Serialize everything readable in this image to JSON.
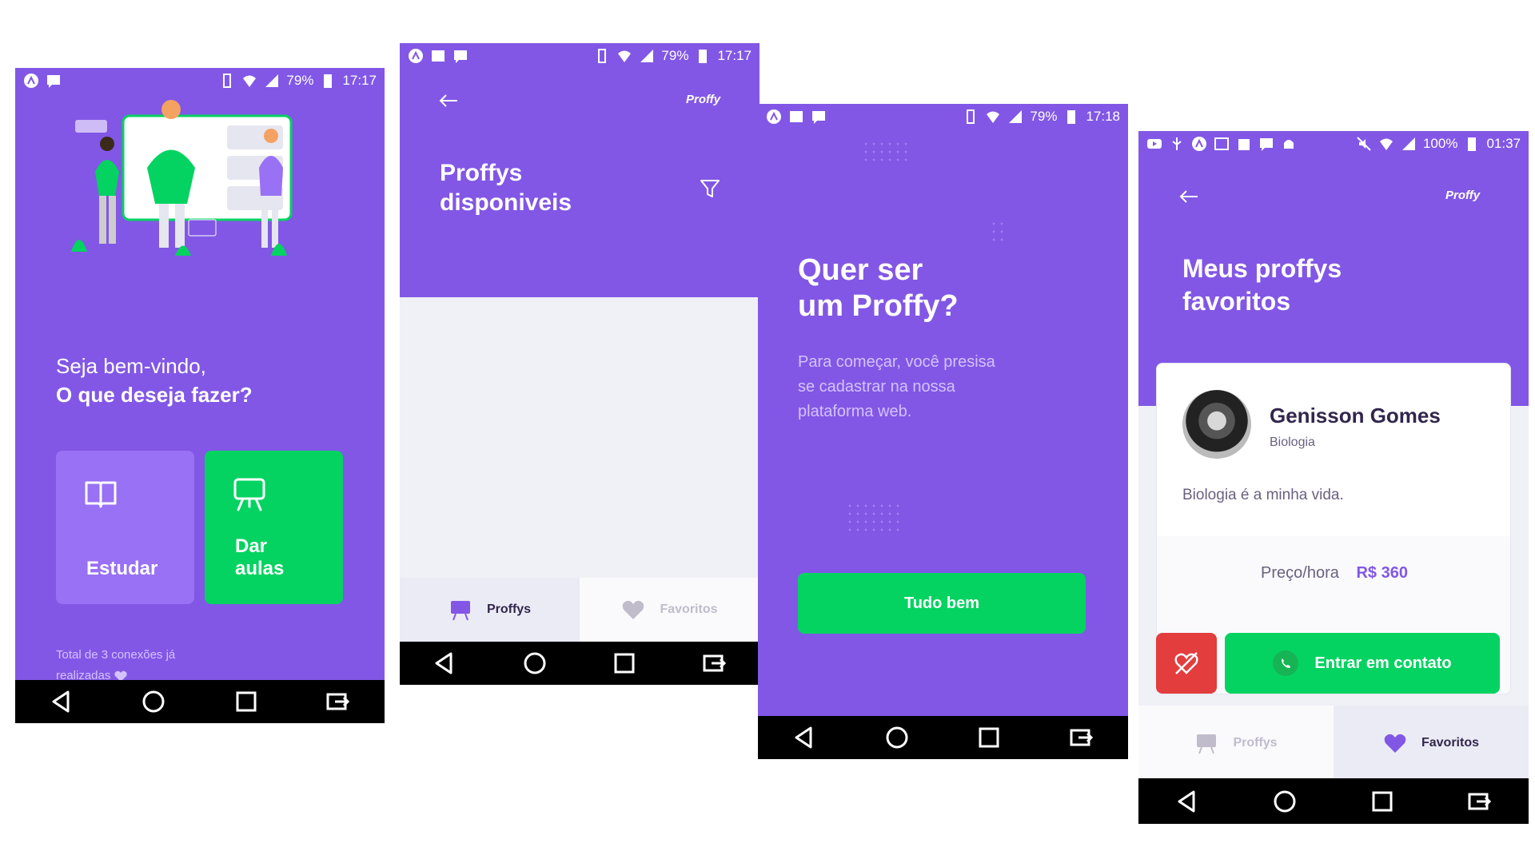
{
  "colors": {
    "purple": "#8257E5",
    "purple_light": "#9871F5",
    "green": "#04D361",
    "red": "#E33D3D",
    "bg": "#F0F0F7"
  },
  "screen1": {
    "status": {
      "battery": "79%",
      "time": "17:17"
    },
    "welcome_line1": "Seja bem-vindo,",
    "welcome_line2": "O que deseja fazer?",
    "study_label": "Estudar",
    "teach_label_1": "Dar",
    "teach_label_2": "aulas",
    "connections_1": "Total de 3 conexões já",
    "connections_2": "realizadas"
  },
  "screen2": {
    "status": {
      "battery": "79%",
      "time": "17:17"
    },
    "brand": "Proffy",
    "title_1": "Proffys",
    "title_2": "disponiveis",
    "tabs": [
      {
        "label": "Proffys",
        "icon": "easel-icon",
        "active": true
      },
      {
        "label": "Favoritos",
        "icon": "heart-icon",
        "active": false
      }
    ]
  },
  "screen3": {
    "status": {
      "battery": "79%",
      "time": "17:18"
    },
    "title_1": "Quer ser",
    "title_2": "um Proffy?",
    "desc_1": "Para começar, você presisa",
    "desc_2": "se cadastrar na nossa",
    "desc_3": "plataforma web.",
    "button": "Tudo bem"
  },
  "screen4": {
    "status": {
      "battery": "100%",
      "time": "01:37"
    },
    "brand": "Proffy",
    "title_1": "Meus proffys",
    "title_2": "favoritos",
    "teacher": {
      "name": "Genisson Gomes",
      "subject": "Biologia",
      "bio": "Biologia é a minha vida."
    },
    "price_label": "Preço/hora",
    "price_value": "R$ 360",
    "contact_button": "Entrar em contato",
    "tabs": [
      {
        "label": "Proffys",
        "icon": "easel-icon",
        "active": false
      },
      {
        "label": "Favoritos",
        "icon": "heart-icon",
        "active": true
      }
    ]
  }
}
